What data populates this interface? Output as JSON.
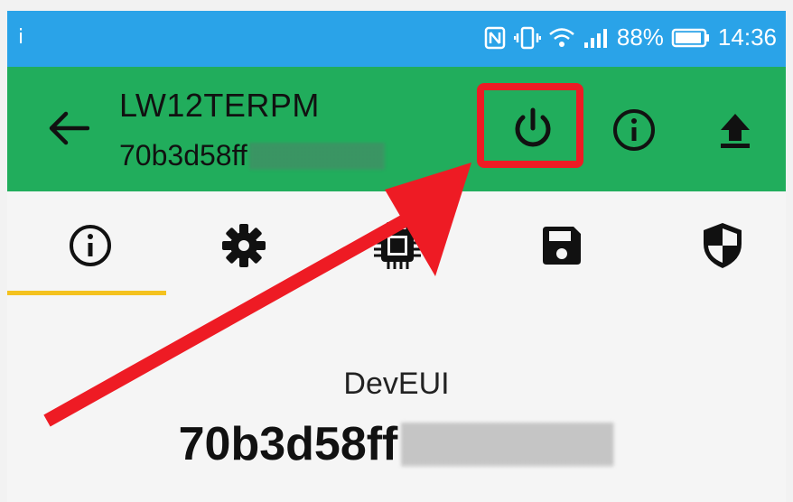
{
  "status_bar": {
    "left_indicator": "ⅰ",
    "battery": "88%",
    "time": "14:36",
    "icons": [
      "nfc-icon",
      "vibrate-icon",
      "wifi-icon",
      "signal-icon",
      "battery-icon"
    ]
  },
  "app_bar": {
    "title": "LW12TERPM",
    "subtitle_visible": "70b3d58ff",
    "actions": [
      "power-icon",
      "info-icon",
      "upload-icon"
    ]
  },
  "tabs": {
    "items": [
      "info-icon",
      "gear-icon",
      "chip-icon",
      "save-icon",
      "shield-icon"
    ],
    "active_index": 0
  },
  "content": {
    "label": "DevEUI",
    "value_visible": "70b3d58ff"
  },
  "colors": {
    "status_bar": "#2aa3e8",
    "app_bar": "#21ad5c",
    "highlight": "#ee1b24",
    "tab_indicator": "#f4c21f"
  }
}
